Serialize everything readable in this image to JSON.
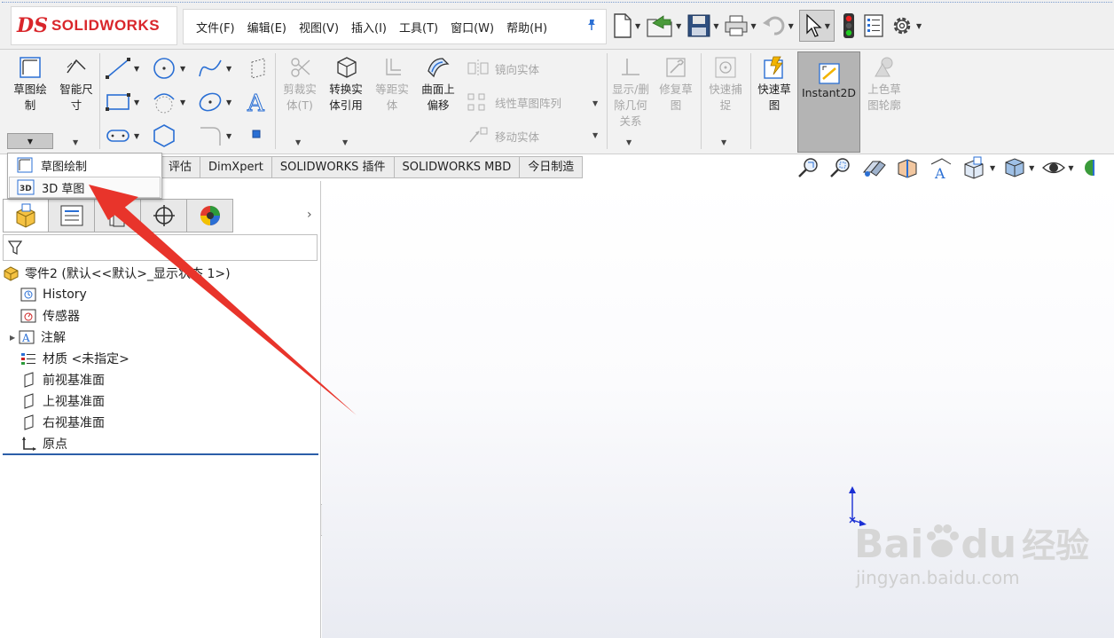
{
  "app": {
    "logo_ds": "DS",
    "logo_text": "SOLIDWORKS"
  },
  "menu": [
    "文件(F)",
    "编辑(E)",
    "视图(V)",
    "插入(I)",
    "工具(T)",
    "窗口(W)",
    "帮助(H)"
  ],
  "ribbon": {
    "sketch": "草图绘制",
    "smart_dim": "智能尺寸",
    "trim": "剪裁实体(T)",
    "convert": "转换实体引用",
    "offset": "等距实体",
    "surface_offset": "曲面上偏移",
    "mirror": "镜向实体",
    "linear_pattern": "线性草图阵列",
    "move": "移动实体",
    "display_relations": "显示/删除几何关系",
    "repair": "修复草图",
    "quick_snaps": "快速捕捉",
    "rapid_sketch": "快速草图",
    "instant2d": "Instant2D",
    "shaded_contours": "上色草图轮廓"
  },
  "tabs": [
    "评估",
    "DimXpert",
    "SOLIDWORKS 插件",
    "SOLIDWORKS MBD",
    "今日制造"
  ],
  "dropdown": {
    "item1": "草图绘制",
    "item2": "3D 草图",
    "icon2": "3D"
  },
  "tree": {
    "root": "零件2 (默认<<默认>_显示状态 1>)",
    "items": [
      {
        "label": "History",
        "icon": "history-icon"
      },
      {
        "label": "传感器",
        "icon": "sensor-icon"
      },
      {
        "label": "注解",
        "icon": "annotation-icon",
        "expandable": true
      },
      {
        "label": "材质 <未指定>",
        "icon": "material-icon"
      },
      {
        "label": "前视基准面",
        "icon": "plane-icon"
      },
      {
        "label": "上视基准面",
        "icon": "plane-icon"
      },
      {
        "label": "右视基准面",
        "icon": "plane-icon"
      },
      {
        "label": "原点",
        "icon": "origin-icon"
      }
    ]
  },
  "watermark": {
    "brand_a": "Bai",
    "brand_b": "du",
    "brand_cn": "经验",
    "url": "jingyan.baidu.com"
  },
  "colors": {
    "accent": "#d9262b",
    "arrow": "#e8342b",
    "selection": "#2c5ea8"
  }
}
